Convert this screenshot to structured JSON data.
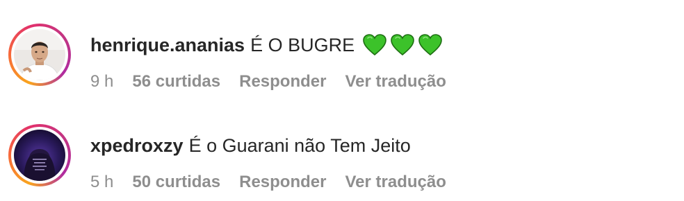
{
  "colors": {
    "text_primary": "#262626",
    "text_secondary": "#8e8e8e",
    "heart_green": "#3cc22a",
    "story_ring": [
      "#f9a51e",
      "#e1306c",
      "#c13584"
    ]
  },
  "comments": [
    {
      "username": "henrique.ananias",
      "text": "É O BUGRE",
      "emoji": [
        "green-heart",
        "green-heart",
        "green-heart"
      ],
      "time": "9 h",
      "likes": "56 curtidas",
      "reply_label": "Responder",
      "translate_label": "Ver tradução"
    },
    {
      "username": "xpedroxzy",
      "text": "É o Guarani não Tem Jeito",
      "emoji": [],
      "time": "5 h",
      "likes": "50 curtidas",
      "reply_label": "Responder",
      "translate_label": "Ver tradução"
    }
  ]
}
